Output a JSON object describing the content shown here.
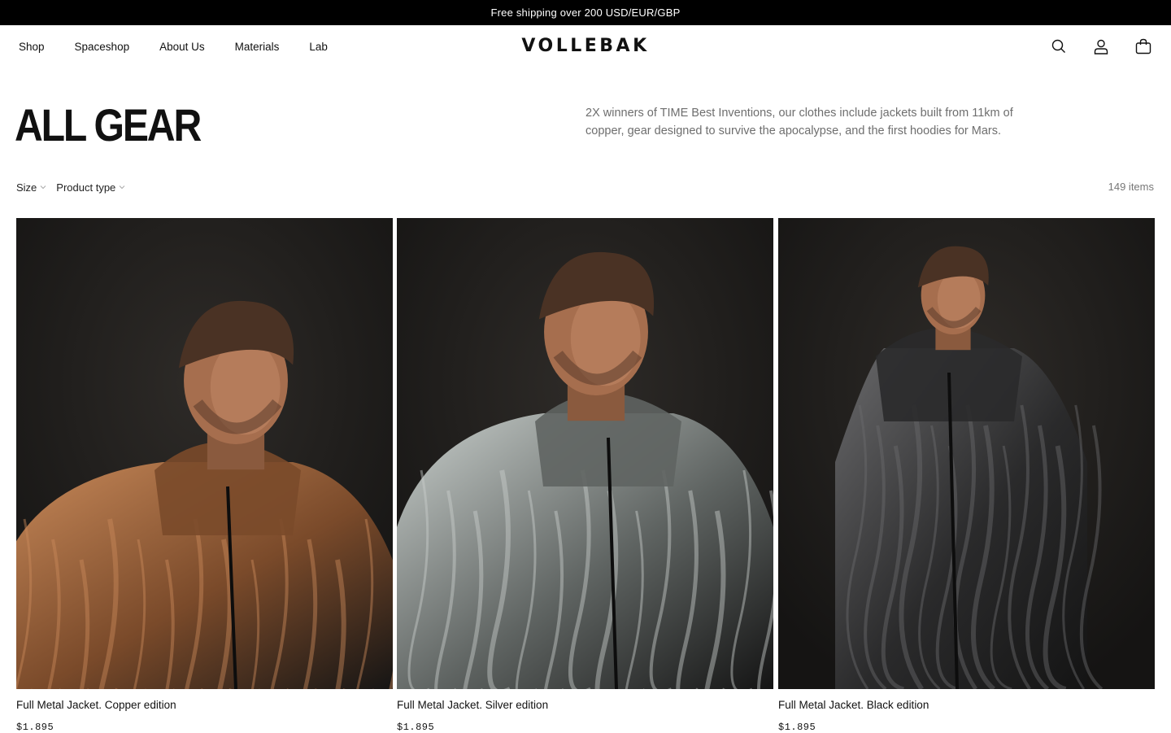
{
  "announcement": {
    "text": "Free shipping over 200 USD/EUR/GBP"
  },
  "header": {
    "logo": "VOLLEBAK",
    "nav": [
      {
        "label": "Shop"
      },
      {
        "label": "Spaceshop"
      },
      {
        "label": "About Us"
      },
      {
        "label": "Materials"
      },
      {
        "label": "Lab"
      }
    ],
    "icons": [
      "search-icon",
      "account-icon",
      "bag-icon"
    ]
  },
  "collection": {
    "title": "ALL GEAR",
    "description": "2X winners of TIME Best Inventions, our clothes include jackets built from 11km of copper, gear designed to survive the apocalypse, and the first hoodies for Mars.",
    "filters": [
      {
        "label": "Size"
      },
      {
        "label": "Product type"
      }
    ],
    "item_count": "149 items"
  },
  "products": [
    {
      "name": "Full Metal Jacket. Copper edition",
      "price": "$1.895",
      "jacket_color": "#7a4a2a",
      "highlight": "#c98a5a"
    },
    {
      "name": "Full Metal Jacket. Silver edition",
      "price": "$1.895",
      "jacket_color": "#5f6462",
      "highlight": "#c9cfcc"
    },
    {
      "name": "Full Metal Jacket. Black edition",
      "price": "$1.895",
      "jacket_color": "#2a2a2b",
      "highlight": "#6a6a6c"
    }
  ],
  "colors": {
    "announcement_bg": "#000000",
    "text": "#111111",
    "muted": "#6e6e6e"
  }
}
